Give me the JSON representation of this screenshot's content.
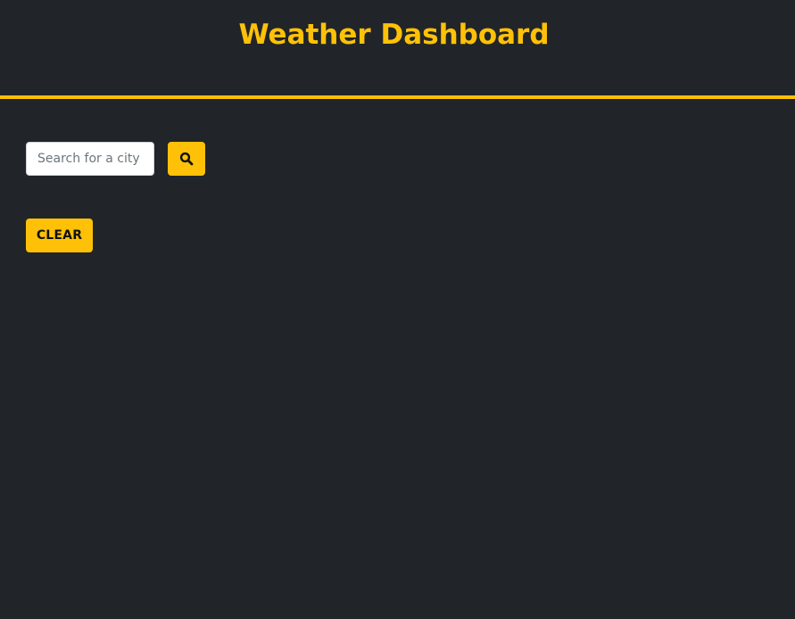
{
  "header": {
    "title": "Weather Dashboard"
  },
  "search": {
    "placeholder": "Search for a city",
    "value": "",
    "button_icon": "search-icon"
  },
  "actions": {
    "clear_label": "CLEAR"
  },
  "colors": {
    "background": "#212529",
    "accent": "#ffc107",
    "input_background": "#ffffff",
    "button_text": "#111111"
  }
}
